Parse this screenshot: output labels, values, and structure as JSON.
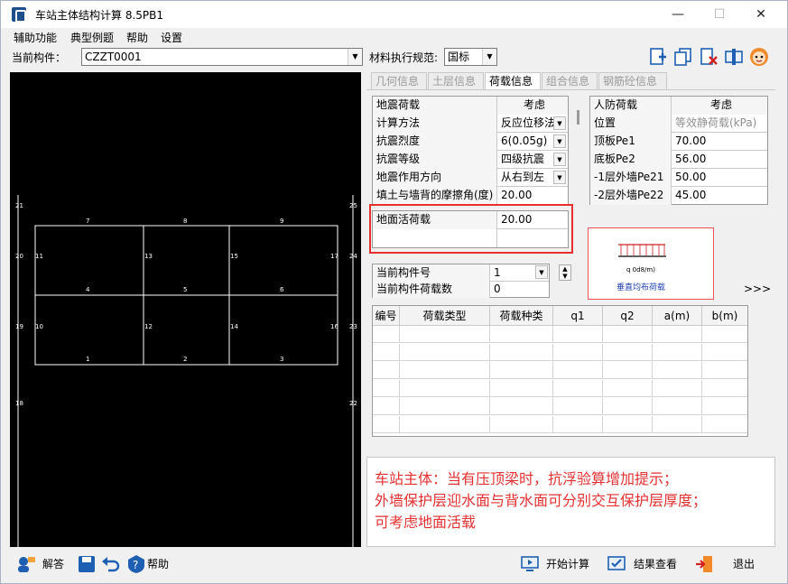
{
  "titlebar": {
    "title": "车站主体结构计算 8.5PB1",
    "minimize": "—",
    "maximize": "☐",
    "close": "✕"
  },
  "menu": [
    "辅助功能",
    "典型例题",
    "帮助",
    "设置"
  ],
  "toolbar": {
    "component_label": "当前构件：",
    "component_value": "CZZT0001",
    "spec_label": "材料执行规范:",
    "spec_value": "国标"
  },
  "tabs": [
    "几何信息",
    "土层信息",
    "荷载信息",
    "组合信息",
    "钢筋砼信息"
  ],
  "active_tab": "荷载信息",
  "seismic": {
    "header": [
      "地震荷载",
      "考虑"
    ],
    "rows": [
      {
        "label": "计算方法",
        "value": "反应位移法"
      },
      {
        "label": "抗震烈度",
        "value": "6(0.05g)"
      },
      {
        "label": "抗震等级",
        "value": "四级抗震"
      },
      {
        "label": "地震作用方向",
        "value": "从右到左"
      },
      {
        "label": "填土与墙背的摩擦角(度)",
        "value": "20.00"
      }
    ]
  },
  "live_load": {
    "label": "地面活荷载",
    "value": "20.00"
  },
  "civil_defense": {
    "header": [
      "人防荷载",
      "考虑"
    ],
    "rows": [
      {
        "label": "位置",
        "value": "等效静荷载(kPa)"
      },
      {
        "label": "顶板Pe1",
        "value": "70.00"
      },
      {
        "label": "底板Pe2",
        "value": "56.00"
      },
      {
        "label": "-1层外墙Pe21",
        "value": "50.00"
      },
      {
        "label": "-2层外墙Pe22",
        "value": "45.00"
      }
    ]
  },
  "current": {
    "component_no_label": "当前构件号",
    "component_no_value": "1",
    "load_count_label": "当前构件荷载数",
    "load_count_value": "0"
  },
  "load_image": {
    "q_label": "q  0d8/m)",
    "caption": "垂直均布荷载",
    "more": ">>>"
  },
  "load_table": {
    "headers": [
      "编号",
      "荷载类型",
      "荷载种类",
      "q1",
      "q2",
      "a(m)",
      "b(m)"
    ],
    "empty_rows": 6
  },
  "hint": [
    "车站主体：当有压顶梁时，抗浮验算增加提示；",
    "外墙保护层迎水面与背水面可分别交互保护层厚度；",
    "可考虑地面活载"
  ],
  "bottom": {
    "answer": "解答",
    "help": "帮助",
    "start": "开始计算",
    "result": "结果查看",
    "exit": "退出"
  },
  "frame": {
    "node_labels": [
      "1",
      "2",
      "3",
      "4",
      "5",
      "6",
      "7",
      "8",
      "9",
      "10",
      "11",
      "12",
      "13",
      "14",
      "15",
      "16",
      "17",
      "18",
      "19",
      "20",
      "21",
      "22",
      "23",
      "24",
      "25"
    ]
  },
  "colors": {
    "accent_red": "#e53030",
    "canvas_bg": "#000000",
    "line": "#ffffff"
  }
}
